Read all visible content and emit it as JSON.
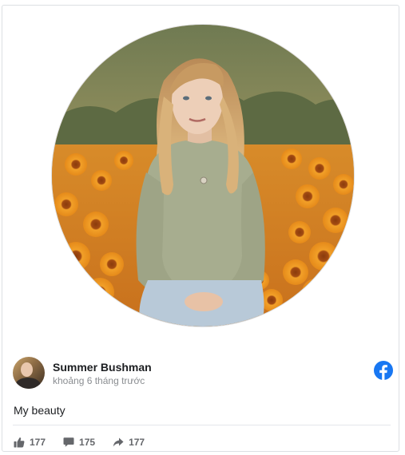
{
  "post": {
    "image": {
      "alt": "",
      "subject_icon": "profile-photo"
    },
    "author": {
      "name": "Summer Bushman",
      "timestamp": "khoảng 6 tháng trước",
      "avatar_icon": "avatar-photo"
    },
    "platform_icon": "facebook-logo-icon",
    "message": "My beauty",
    "stats": {
      "likes": "177",
      "comments": "175",
      "shares": "177"
    }
  },
  "colors": {
    "facebook_blue": "#1877f2",
    "stat_gray": "#65676b",
    "timestamp_gray": "#8a8d91",
    "divider": "#e4e6eb"
  }
}
